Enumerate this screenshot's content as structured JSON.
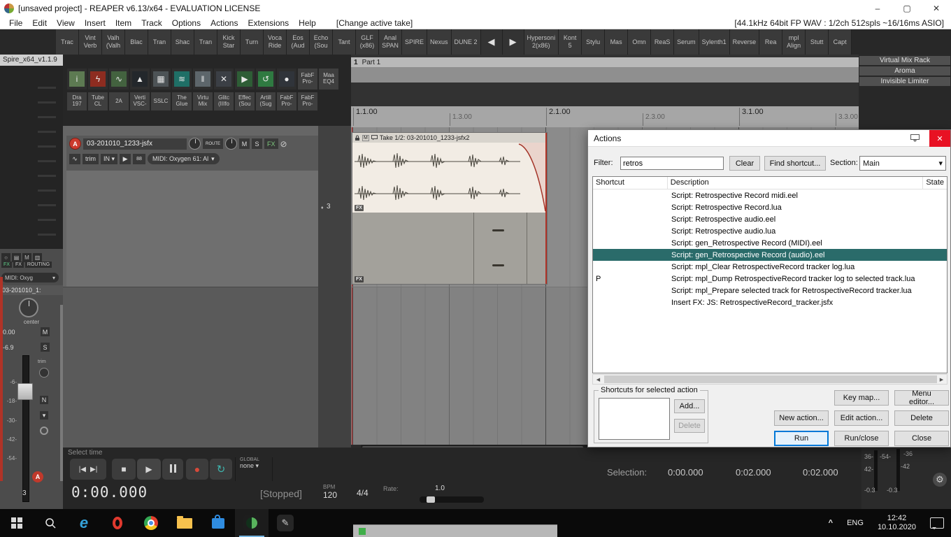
{
  "titlebar": {
    "title": "[unsaved project] - REAPER v6.13/x64 - EVALUATION LICENSE"
  },
  "menubar": {
    "items": [
      "File",
      "Edit",
      "View",
      "Insert",
      "Item",
      "Track",
      "Options",
      "Actions",
      "Extensions",
      "Help"
    ],
    "take_label": "[Change active take]",
    "audio_status": "[44.1kHz 64bit FP WAV : 1/2ch 512spls ~16/16ms ASIO]"
  },
  "toolbar": {
    "left_buttons": [
      "Trac",
      "Vint\nVerb",
      "Valh\n(Valh",
      "Blac",
      "Tran",
      "Shac",
      "Tran",
      "Kick\nStar",
      "Turn",
      "Voca\nRide",
      "Eos\n(Aud",
      "Echo\n(Sou",
      "Tant",
      "GLF\n(x86)",
      "Anal\nSPAN",
      "SPIRE",
      "Nexus",
      "DUNE 2"
    ],
    "right_buttons": [
      "Hypersoni\n2(x86)",
      "Kont\n5",
      "Stylu",
      "Mas",
      "Omn",
      "ReaS",
      "Serum",
      "Sylenth1",
      "Reverse",
      "Rea",
      "mpl\nAlign",
      "Stutt",
      "Capt"
    ]
  },
  "left_panel": {
    "header": "Spire_x64_v1.1.9"
  },
  "fx_dock": {
    "icons": [
      {
        "glyph": "i",
        "color": "#5d7a52"
      },
      {
        "glyph": "ϟ",
        "color": "#8d2c20"
      },
      {
        "glyph": "∿",
        "color": "#43623f"
      },
      {
        "glyph": "▲",
        "color": "#23272b"
      },
      {
        "glyph": "▦",
        "color": "#4d5356"
      },
      {
        "glyph": "≋",
        "color": "#1f6f66"
      },
      {
        "glyph": "‖",
        "color": "#5d666b"
      },
      {
        "glyph": "✕",
        "color": "#3b3f45"
      },
      {
        "glyph": "▶",
        "color": "#2e5d36"
      },
      {
        "glyph": "↺",
        "color": "#2f7a41"
      },
      {
        "glyph": "●",
        "color": "#30343a"
      }
    ],
    "icon_text_tiles": [
      "FabF\nPro-",
      "Maa\nEQ4"
    ],
    "labels": [
      "Dra\n197",
      "Tube\nCL",
      "2A",
      "Verti\nVSC-",
      "SSLC",
      "The\nGlue",
      "Virtu\nMix",
      "Glitc\n(IIIfo",
      "Effec\n(Sou",
      "Artill\n(Sug",
      "FabF\nPro-",
      "FabF\nPro-"
    ]
  },
  "track": {
    "arm_label": "A",
    "name": "03-201010_1233-jsfx",
    "route": "ROUTE",
    "mute": "M",
    "solo": "S",
    "fx": "FX",
    "env": "∿",
    "trim": "trim",
    "input": "IN",
    "mon": "▶",
    "piano": "88",
    "midi_input": "MIDI: Oxygen 61: Al",
    "number": "3"
  },
  "arrange": {
    "region_number": "1",
    "region_name": "Part 1",
    "ruler_labels": [
      "1.1.00",
      "1.3.00",
      "2.1.00",
      "2.3.00",
      "3.1.00",
      "3.3.00"
    ],
    "item_title": "Take 1/2: 03-201010_1233-jsfx2",
    "item_mute": "M",
    "take_fx_badge": "FX"
  },
  "right_panel": {
    "buttons": [
      "Virtual Mix Rack",
      "Aroma",
      "Invisible Limiter"
    ]
  },
  "actions": {
    "title": "Actions",
    "filter_label": "Filter:",
    "filter_value": "retros",
    "clear": "Clear",
    "find_shortcut": "Find shortcut...",
    "section_label": "Section:",
    "section_value": "Main",
    "col_shortcut": "Shortcut",
    "col_description": "Description",
    "col_state": "State",
    "rows": [
      {
        "shortcut": "",
        "description": "Script: Retrospective Record midi.eel"
      },
      {
        "shortcut": "",
        "description": "Script: Retrospective Record.lua"
      },
      {
        "shortcut": "",
        "description": "Script: Retrospective audio.eel"
      },
      {
        "shortcut": "",
        "description": "Script: Retrospective audio.lua"
      },
      {
        "shortcut": "",
        "description": "Script: gen_Retrospective Record (MIDI).eel"
      },
      {
        "shortcut": "",
        "description": "Script: gen_Retrospective Record (audio).eel",
        "_class": "selected"
      },
      {
        "shortcut": "",
        "description": "Script: mpl_Clear RetrospectiveRecord tracker log.lua"
      },
      {
        "shortcut": "P",
        "description": "Script: mpl_Dump RetrospectiveRecord tracker log to selected track.lua"
      },
      {
        "shortcut": "",
        "description": "Script: mpl_Prepare selected track for RetrospectiveRecord tracker.lua"
      },
      {
        "shortcut": "",
        "description": "Insert FX: JS: RetrospectiveRecord_tracker.jsfx"
      }
    ],
    "shortcuts_legend": "Shortcuts for selected action",
    "add": "Add...",
    "delete_shortcut": "Delete",
    "key_map": "Key map...",
    "menu_editor": "Menu editor...",
    "new_action": "New action...",
    "edit_action": "Edit action...",
    "delete": "Delete",
    "run": "Run",
    "run_close": "Run/close",
    "close": "Close"
  },
  "transport": {
    "select_time": "Select time",
    "global": "GLOBAL",
    "global_value": "none",
    "time": "0:00.000",
    "status": "[Stopped]",
    "bpm_label": "BPM",
    "bpm": "120",
    "timesig": "4/4",
    "rate_label": "Rate:",
    "rate": "1.0",
    "selection_label": "Selection:",
    "sel_start": "0:00.000",
    "sel_end": "0:02.000",
    "sel_len": "0:02.000"
  },
  "mixer": {
    "fx_chip": "FX",
    "fx2": "FX",
    "routing": "ROUTING",
    "midi": "MIDI: Oxyg",
    "name": "03-201010_1:",
    "pan": "center",
    "vol": "0.00",
    "readout": "-6.9",
    "mute": "M",
    "solo": "S",
    "trim": "trim",
    "n_badge": "N",
    "scale": [
      "-6-",
      "-18-",
      "-30-",
      "-42-",
      "-54-"
    ],
    "arm": "A",
    "number": "3"
  },
  "meters": {
    "r1a": "36-",
    "r1b": "-54-",
    "r1c": "-36",
    "r2a": "42-",
    "r2b": "-42",
    "r3a": "-0.3",
    "r3b": "-0.3"
  },
  "taskbar": {
    "lang": "ENG",
    "clock_time": "12:42",
    "clock_date": "10.10.2020"
  },
  "icons": {
    "minimize": "–",
    "maximize": "▢",
    "close": "✕",
    "dropdown": "▾",
    "back": "◀",
    "forward": "▶",
    "scroll_left": "◀",
    "scroll_right": "▶",
    "prev": "|◀",
    "next": "▶|",
    "stop": "■",
    "play": "▶",
    "record": "●",
    "repeat": "↻",
    "gear": "⚙",
    "slash": "⊘",
    "diamond": "♦",
    "chevron_up": "^",
    "pencil": "✎",
    "power": "○",
    "grid": "▤",
    "m": "M",
    "hatch": "▥"
  }
}
